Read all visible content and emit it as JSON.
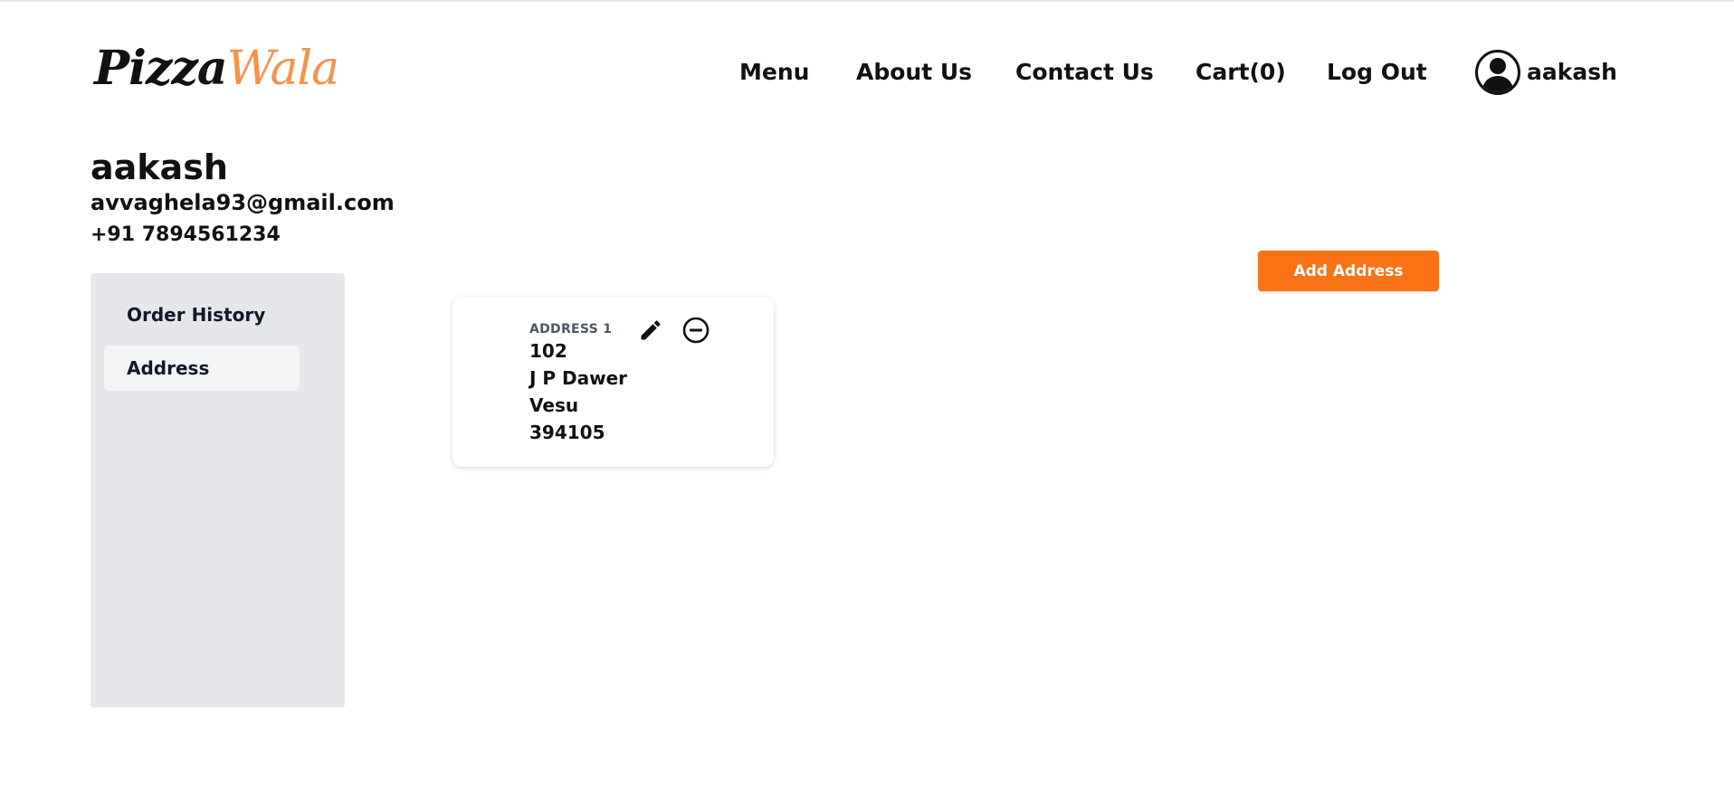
{
  "header": {
    "logo": {
      "part1": "Pizza",
      "part2": "Wala"
    },
    "nav": {
      "menu": "Menu",
      "about": "About Us",
      "contact": "Contact Us",
      "cart": "Cart(0)",
      "logout": "Log Out"
    },
    "user": {
      "name": "aakash",
      "avatar_icon": "user-avatar-icon"
    }
  },
  "profile": {
    "name": "aakash",
    "email": "avvaghela93@gmail.com",
    "phone": "+91 7894561234"
  },
  "sidebar": {
    "items": [
      {
        "label": "Order History",
        "active": false
      },
      {
        "label": "Address",
        "active": true
      }
    ]
  },
  "main": {
    "add_address_label": "Add Address",
    "addresses": [
      {
        "label": "ADDRESS 1",
        "lines": [
          "102",
          "J P Dawer",
          "Vesu",
          "394105"
        ],
        "icons": [
          "pencil-icon",
          "minus-circle-icon"
        ]
      }
    ]
  },
  "colors": {
    "accent": "#f97316",
    "logo_accent": "#f7924a",
    "sidebar_bg": "#e5e7eb",
    "active_item_bg": "#f3f4f6"
  }
}
